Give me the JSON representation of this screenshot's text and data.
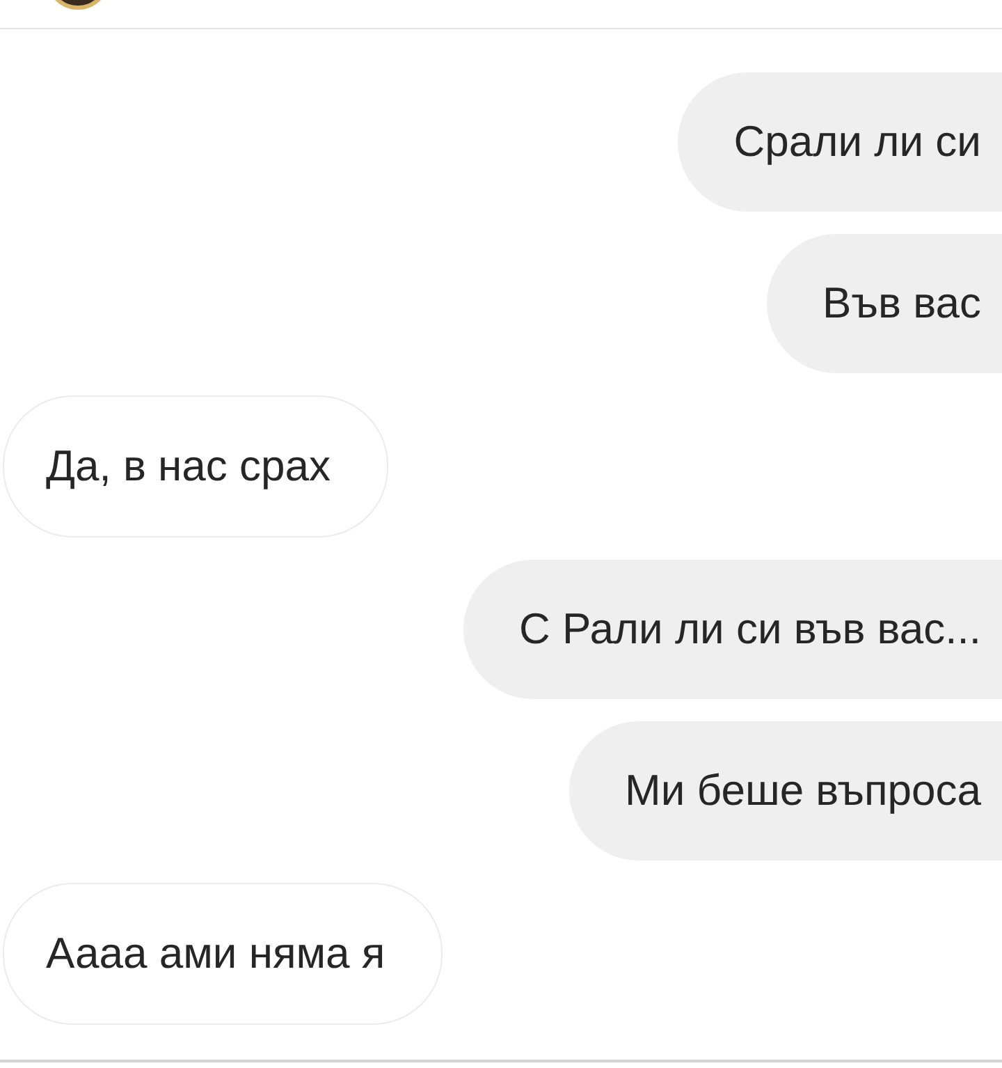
{
  "messages": [
    {
      "kind": "sent",
      "text": "Срали ли си"
    },
    {
      "kind": "sent",
      "text": "Във вас"
    },
    {
      "kind": "received",
      "text": "Да, в нас срах"
    },
    {
      "kind": "sent",
      "text": "С Рали ли си във вас..."
    },
    {
      "kind": "sent",
      "text": "Ми беше въпроса"
    },
    {
      "kind": "received",
      "text": "Аааа ами няма я"
    }
  ]
}
